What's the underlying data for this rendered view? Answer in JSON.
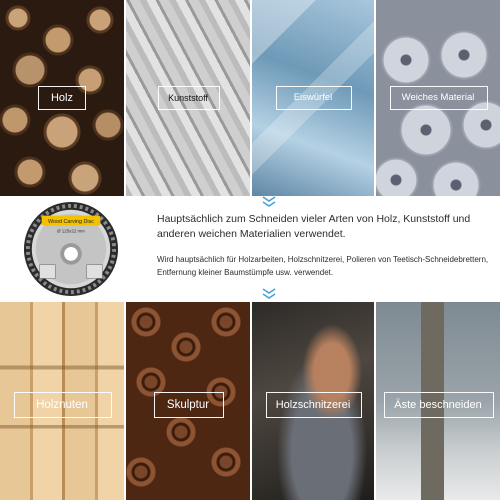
{
  "top_tiles": [
    {
      "label": "Holz"
    },
    {
      "label": "Kunststoff"
    },
    {
      "label": "Eiswürfel"
    },
    {
      "label": "Weiches Material"
    }
  ],
  "bottom_tiles": [
    {
      "label": "Holznuten"
    },
    {
      "label": "Skulptur"
    },
    {
      "label": "Holzschnitzerei"
    },
    {
      "label": "Äste beschneiden"
    }
  ],
  "product": {
    "disc_label": "Wood Carving Disc",
    "disc_size": "Ø 125x22 mm"
  },
  "text": {
    "headline": "Hauptsächlich zum Schneiden vieler Arten von Holz, Kunststoff und anderen weichen Materialien verwendet.",
    "detail": "Wird hauptsächlich für Holzarbeiten, Holzschnitzerei, Polieren von Teetisch-Schneidebrettern, Entfernung kleiner Baumstümpfe usw. verwendet."
  },
  "colors": {
    "chevron": "#4aa3d8",
    "disc_label_bg": "#f2c200"
  }
}
